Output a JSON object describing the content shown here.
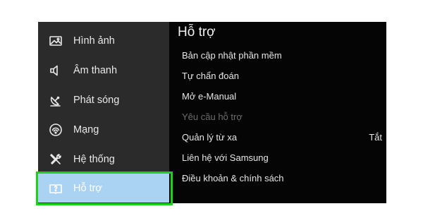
{
  "sidebar": {
    "items": [
      {
        "label": "Hình ảnh",
        "icon": "picture-icon"
      },
      {
        "label": "Âm thanh",
        "icon": "speaker-icon"
      },
      {
        "label": "Phát sóng",
        "icon": "satellite-dish-icon"
      },
      {
        "label": "Mạng",
        "icon": "network-icon"
      },
      {
        "label": "Hệ thống",
        "icon": "tools-icon"
      },
      {
        "label": "Hỗ trợ",
        "icon": "support-book-icon",
        "selected": true
      }
    ]
  },
  "panel": {
    "title": "Hỗ trợ",
    "items": [
      {
        "label": "Bản cập nhật phần mềm"
      },
      {
        "label": "Tự chẩn đoán"
      },
      {
        "label": "Mở e-Manual"
      },
      {
        "label": "Yêu cầu hỗ trợ",
        "disabled": true
      },
      {
        "label": "Quản lý từ xa",
        "value": "Tắt"
      },
      {
        "label": "Liên hệ với Samsung"
      },
      {
        "label": "Điều khoản & chính sách"
      }
    ]
  },
  "colors": {
    "screen_bg": "#050505",
    "sidebar_bg": "#2b2b2b",
    "selected_bg": "#a9d2f3",
    "highlight_border": "#19d21c",
    "disabled_text": "#6c6c6c"
  }
}
